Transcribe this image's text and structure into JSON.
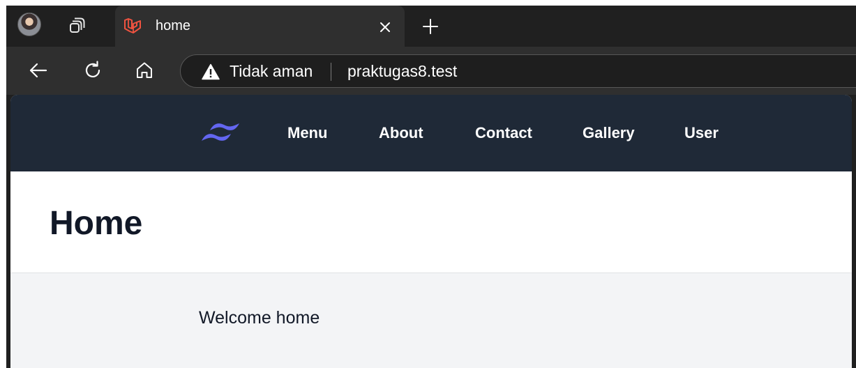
{
  "browser": {
    "tab": {
      "title": "home"
    },
    "omnibox": {
      "security_label": "Tidak aman",
      "url": "praktugas8.test"
    },
    "colors": {
      "chrome_dark": "#202020",
      "toolbar": "#2f2f2f",
      "favicon_red": "#f05340"
    },
    "icons": [
      "profile-avatar",
      "tab-actions-icon",
      "laravel-icon",
      "close-icon",
      "plus-icon",
      "back-arrow-icon",
      "refresh-icon",
      "home-icon",
      "warning-icon"
    ]
  },
  "site": {
    "nav": {
      "items": [
        {
          "label": "Menu"
        },
        {
          "label": "About"
        },
        {
          "label": "Contact"
        },
        {
          "label": "Gallery"
        },
        {
          "label": "User"
        }
      ]
    },
    "header": {
      "title": "Home"
    },
    "main": {
      "text": "Welcome home"
    },
    "colors": {
      "nav_bg": "#1f2937",
      "logo": "#6366f1",
      "body_bg": "#f3f4f6",
      "text": "#111827"
    }
  }
}
